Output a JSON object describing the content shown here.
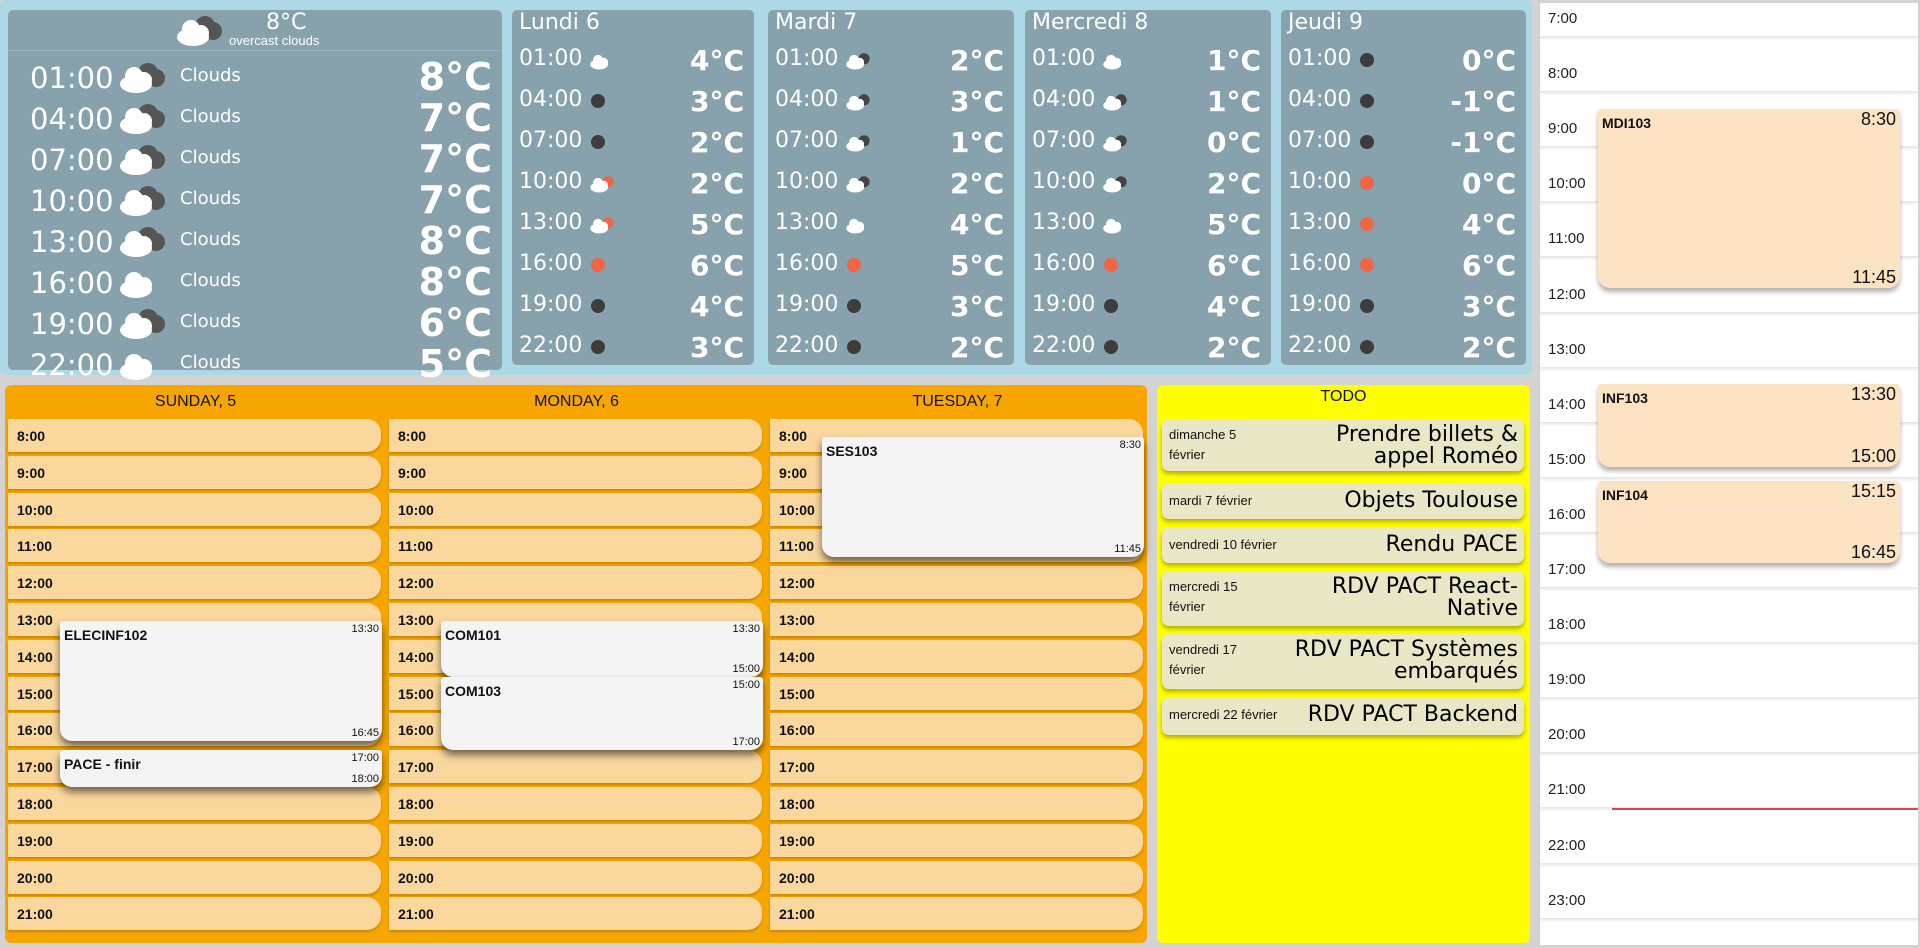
{
  "weather": {
    "today": {
      "current_temp": "8°C",
      "current_desc": "overcast clouds",
      "icon": "broken-clouds-icon",
      "hours": [
        {
          "time": "01:00",
          "cond": "Clouds",
          "temp": "8°C",
          "icon": "broken-clouds-icon"
        },
        {
          "time": "04:00",
          "cond": "Clouds",
          "temp": "7°C",
          "icon": "broken-clouds-icon"
        },
        {
          "time": "07:00",
          "cond": "Clouds",
          "temp": "7°C",
          "icon": "broken-clouds-icon"
        },
        {
          "time": "10:00",
          "cond": "Clouds",
          "temp": "7°C",
          "icon": "broken-clouds-icon"
        },
        {
          "time": "13:00",
          "cond": "Clouds",
          "temp": "8°C",
          "icon": "broken-clouds-icon"
        },
        {
          "time": "16:00",
          "cond": "Clouds",
          "temp": "8°C",
          "icon": "cloud-icon"
        },
        {
          "time": "19:00",
          "cond": "Clouds",
          "temp": "6°C",
          "icon": "broken-clouds-icon"
        },
        {
          "time": "22:00",
          "cond": "Clouds",
          "temp": "5°C",
          "icon": "cloud-icon"
        }
      ]
    },
    "days": [
      {
        "title": "Lundi 6",
        "hours": [
          {
            "time": "01:00",
            "temp": "4°C",
            "icon": "cloud-icon"
          },
          {
            "time": "04:00",
            "temp": "3°C",
            "icon": "night-dot-icon"
          },
          {
            "time": "07:00",
            "temp": "2°C",
            "icon": "night-dot-icon"
          },
          {
            "time": "10:00",
            "temp": "2°C",
            "icon": "cloud-sun-icon"
          },
          {
            "time": "13:00",
            "temp": "5°C",
            "icon": "cloud-sun-icon"
          },
          {
            "time": "16:00",
            "temp": "6°C",
            "icon": "sun-dot-icon"
          },
          {
            "time": "19:00",
            "temp": "4°C",
            "icon": "night-dot-icon"
          },
          {
            "time": "22:00",
            "temp": "3°C",
            "icon": "night-dot-icon"
          }
        ]
      },
      {
        "title": "Mardi 7",
        "hours": [
          {
            "time": "01:00",
            "temp": "2°C",
            "icon": "cloud-night-icon"
          },
          {
            "time": "04:00",
            "temp": "3°C",
            "icon": "cloud-night-icon"
          },
          {
            "time": "07:00",
            "temp": "1°C",
            "icon": "cloud-night-icon"
          },
          {
            "time": "10:00",
            "temp": "2°C",
            "icon": "cloud-night-icon"
          },
          {
            "time": "13:00",
            "temp": "4°C",
            "icon": "cloud-icon"
          },
          {
            "time": "16:00",
            "temp": "5°C",
            "icon": "sun-dot-icon"
          },
          {
            "time": "19:00",
            "temp": "3°C",
            "icon": "night-dot-icon"
          },
          {
            "time": "22:00",
            "temp": "2°C",
            "icon": "night-dot-icon"
          }
        ]
      },
      {
        "title": "Mercredi 8",
        "hours": [
          {
            "time": "01:00",
            "temp": "1°C",
            "icon": "cloud-icon"
          },
          {
            "time": "04:00",
            "temp": "1°C",
            "icon": "cloud-night-icon"
          },
          {
            "time": "07:00",
            "temp": "0°C",
            "icon": "cloud-night-icon"
          },
          {
            "time": "10:00",
            "temp": "2°C",
            "icon": "cloud-night-icon"
          },
          {
            "time": "13:00",
            "temp": "5°C",
            "icon": "cloud-icon"
          },
          {
            "time": "16:00",
            "temp": "6°C",
            "icon": "sun-dot-icon"
          },
          {
            "time": "19:00",
            "temp": "4°C",
            "icon": "night-dot-icon"
          },
          {
            "time": "22:00",
            "temp": "2°C",
            "icon": "night-dot-icon"
          }
        ]
      },
      {
        "title": "Jeudi 9",
        "hours": [
          {
            "time": "01:00",
            "temp": "0°C",
            "icon": "night-dot-icon"
          },
          {
            "time": "04:00",
            "temp": "-1°C",
            "icon": "night-dot-icon"
          },
          {
            "time": "07:00",
            "temp": "-1°C",
            "icon": "night-dot-icon"
          },
          {
            "time": "10:00",
            "temp": "0°C",
            "icon": "sun-dot-icon"
          },
          {
            "time": "13:00",
            "temp": "4°C",
            "icon": "sun-dot-icon"
          },
          {
            "time": "16:00",
            "temp": "6°C",
            "icon": "sun-dot-icon"
          },
          {
            "time": "19:00",
            "temp": "3°C",
            "icon": "night-dot-icon"
          },
          {
            "time": "22:00",
            "temp": "2°C",
            "icon": "night-dot-icon"
          }
        ]
      }
    ]
  },
  "calendar": {
    "slots": [
      "8:00",
      "9:00",
      "10:00",
      "11:00",
      "12:00",
      "13:00",
      "14:00",
      "15:00",
      "16:00",
      "17:00",
      "18:00",
      "19:00",
      "20:00",
      "21:00"
    ],
    "days": [
      {
        "title": "SUNDAY, 5",
        "events": [
          {
            "name": "ELECINF102",
            "start": "13:30",
            "end": "16:45"
          },
          {
            "name": "PACE - finir",
            "start": "17:00",
            "end": "18:00"
          }
        ]
      },
      {
        "title": "MONDAY, 6",
        "events": [
          {
            "name": "COM101",
            "start": "13:30",
            "end": "15:00"
          },
          {
            "name": "COM103",
            "start": "15:00",
            "end": "17:00"
          }
        ]
      },
      {
        "title": "TUESDAY, 7",
        "events": [
          {
            "name": "SES103",
            "start": "8:30",
            "end": "11:45"
          }
        ]
      }
    ]
  },
  "todo": {
    "title": "TODO",
    "items": [
      {
        "date": "dimanche 5 février",
        "label": "Prendre billets & appel Roméo"
      },
      {
        "date": "mardi 7 février",
        "label": "Objets Toulouse"
      },
      {
        "date": "vendredi 10 février",
        "label": "Rendu PACE"
      },
      {
        "date": "mercredi 15 février",
        "label": "RDV PACT React-Native"
      },
      {
        "date": "vendredi 17 février",
        "label": "RDV PACT Systèmes embarqués"
      },
      {
        "date": "mercredi 22 février",
        "label": "RDV PACT Backend"
      }
    ]
  },
  "day_view": {
    "hours": [
      "7:00",
      "8:00",
      "9:00",
      "10:00",
      "11:00",
      "12:00",
      "13:00",
      "14:00",
      "15:00",
      "16:00",
      "17:00",
      "18:00",
      "19:00",
      "20:00",
      "21:00",
      "22:00",
      "23:00"
    ],
    "events": [
      {
        "name": "MDI103",
        "start": "8:30",
        "end": "11:45"
      },
      {
        "name": "INF103",
        "start": "13:30",
        "end": "15:00"
      },
      {
        "name": "INF104",
        "start": "15:15",
        "end": "16:45"
      }
    ],
    "now_color": "#e05050"
  },
  "colors": {
    "weather_bg": "#add8e6",
    "weather_card": "#87a2ad",
    "calendar_bg": "#f7a500",
    "slot_bg": "#f9d79d",
    "todo_bg": "#ffff00",
    "event_bg": "#fce3c4"
  }
}
